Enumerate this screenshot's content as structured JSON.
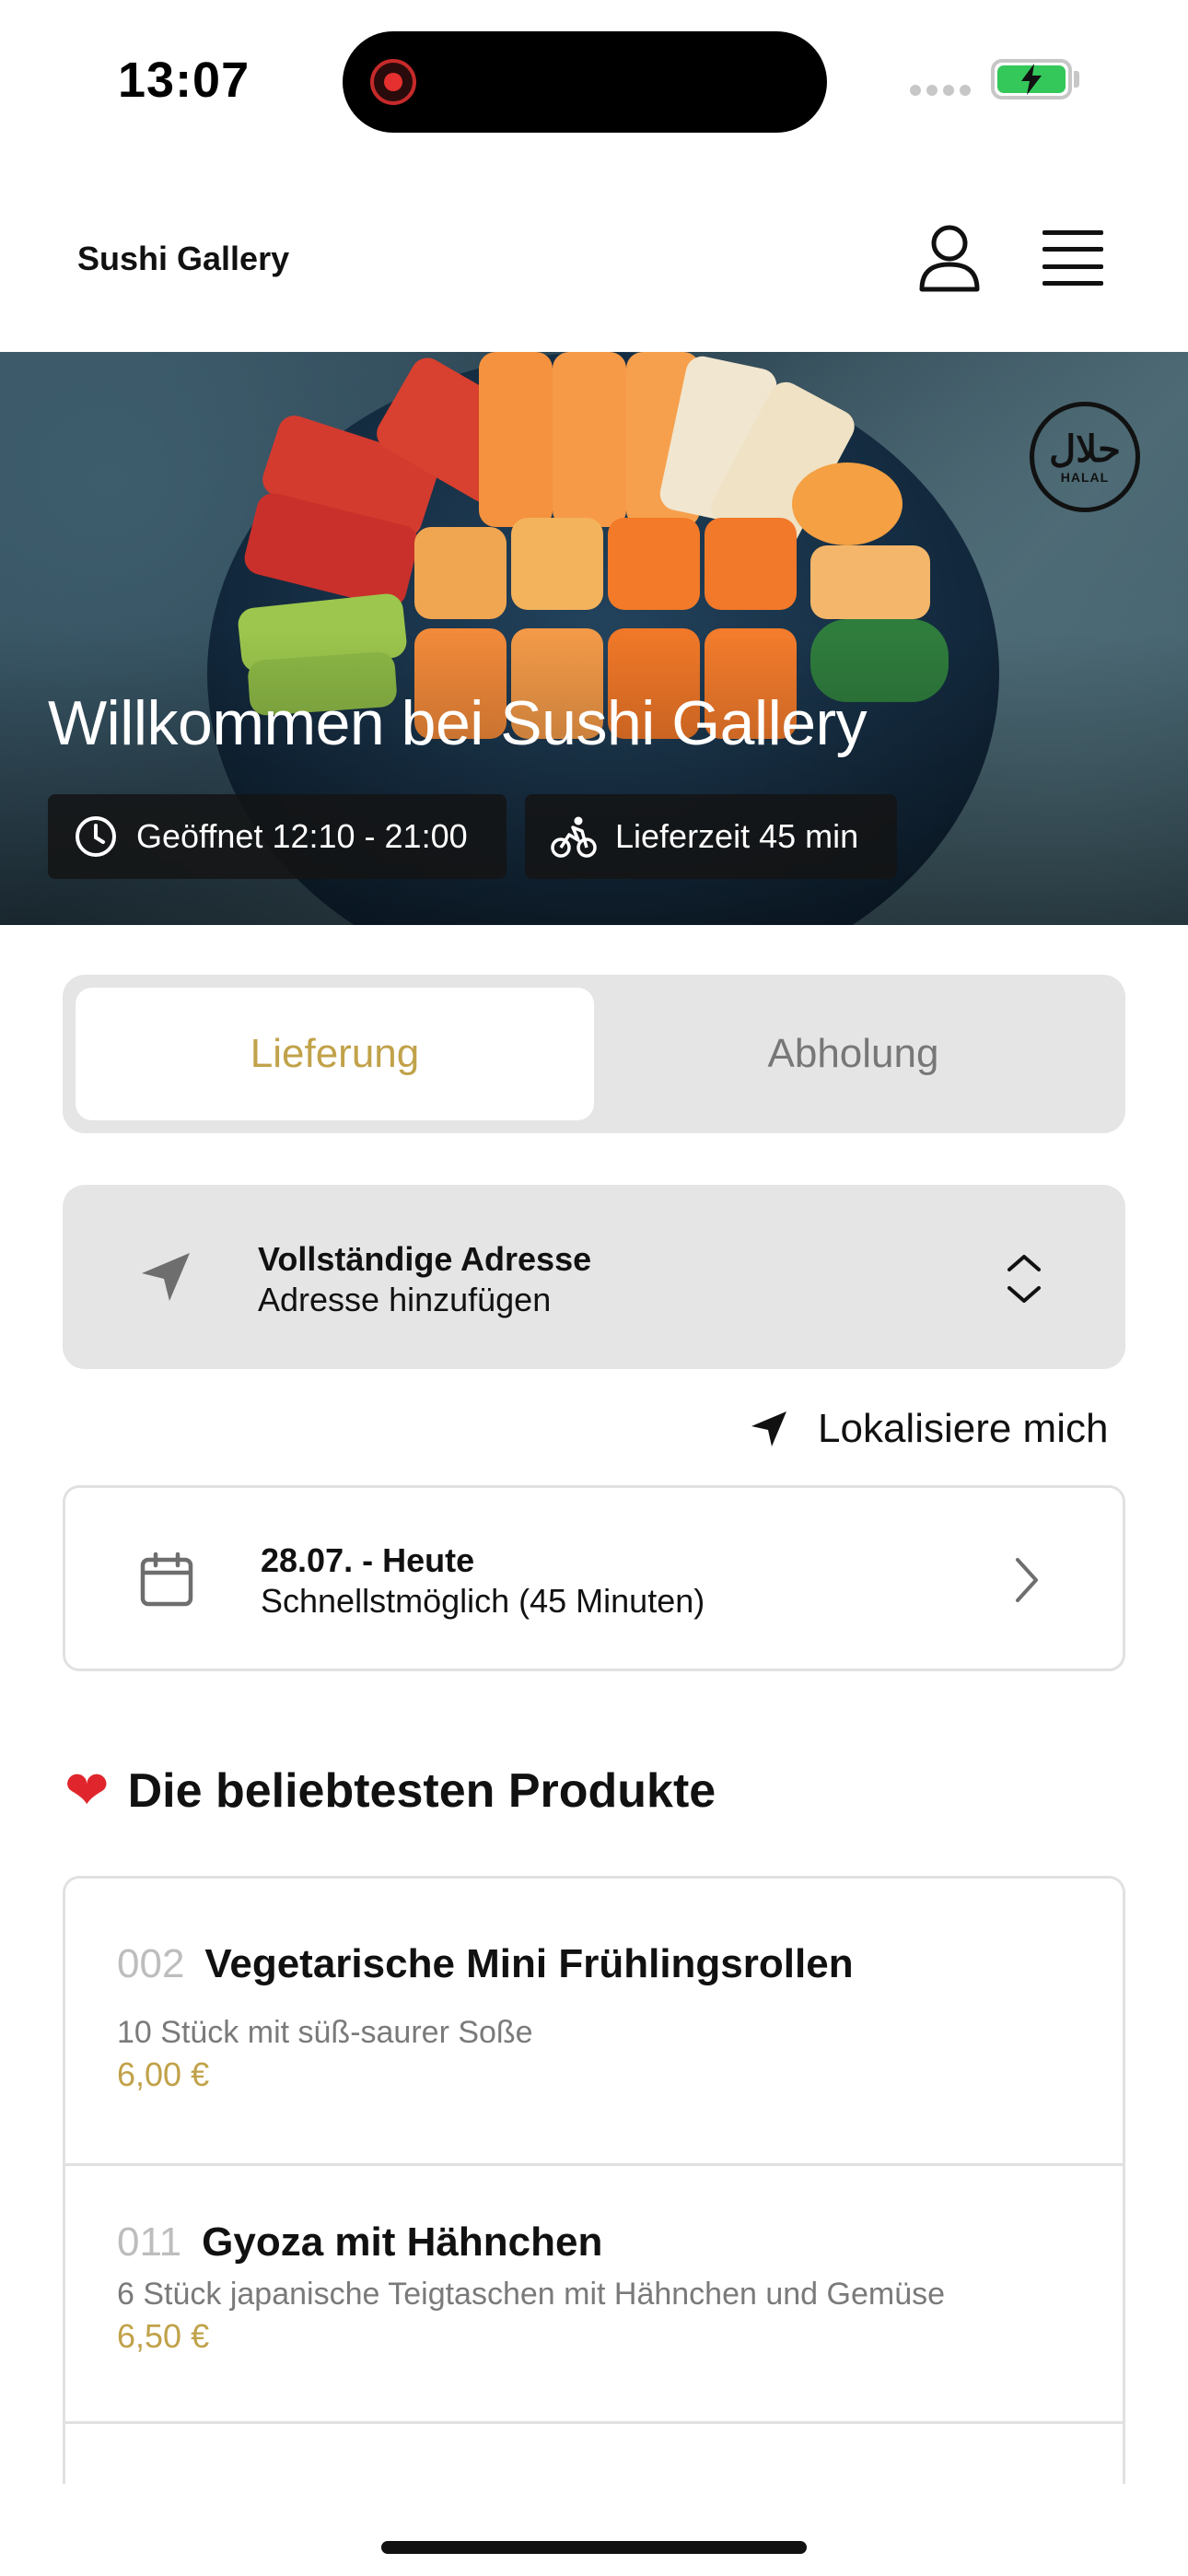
{
  "status_bar": {
    "time": "13:07"
  },
  "header": {
    "brand": "Sushi Gallery"
  },
  "hero": {
    "title": "Willkommen bei Sushi Gallery",
    "halal_arabic": "حلال",
    "halal_label": "HALAL",
    "open_hours": "Geöffnet 12:10 - 21:00",
    "delivery_time": "Lieferzeit 45 min"
  },
  "segment": {
    "active": "Lieferung",
    "inactive": "Abholung"
  },
  "address": {
    "title": "Vollständige Adresse",
    "subtitle": "Adresse hinzufügen"
  },
  "locate": {
    "label": "Lokalisiere mich"
  },
  "date": {
    "title": "28.07. - Heute",
    "subtitle": "Schnellstmöglich (45 Minuten)"
  },
  "popular": {
    "title": "Die beliebtesten Produkte",
    "items": [
      {
        "number": "002",
        "name": "Vegetarische Mini Frühlingsrollen",
        "description": "10 Stück mit süß-saurer Soße",
        "price": "6,00 €"
      },
      {
        "number": "011",
        "name": "Gyoza mit Hähnchen",
        "description": "6 Stück japanische Teigtaschen mit Hähnchen und Gemüse",
        "price": "6,50 €"
      }
    ]
  },
  "colors": {
    "accent": "#c1a24a",
    "card_bg": "#e5e5e5",
    "border": "#e1e1e1"
  }
}
